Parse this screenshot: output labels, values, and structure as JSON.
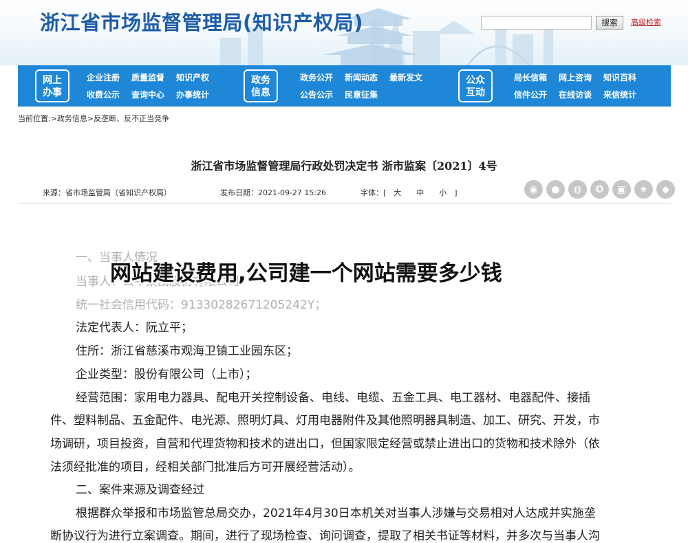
{
  "header": {
    "site_title": "浙江省市场监督管理局(知识产权局)",
    "search_button": "搜索",
    "advanced_search": "高级检索"
  },
  "nav": {
    "groups": [
      {
        "badge": [
          "网上",
          "办事"
        ],
        "links": [
          "企业注册",
          "质量监督",
          "知识产权",
          "收费公示",
          "查询中心",
          "办事统计"
        ]
      },
      {
        "badge": [
          "政务",
          "信息"
        ],
        "links": [
          "政务公开",
          "新闻动态",
          "最新发文",
          "公告公示",
          "民意征集"
        ]
      },
      {
        "badge": [
          "公众",
          "互动"
        ],
        "links": [
          "局长信箱",
          "网上咨询",
          "知识百科",
          "信件公开",
          "在线访谈",
          "来信统计"
        ]
      }
    ]
  },
  "breadcrumb": "当前位置:>政务信息>反垄断、反不正当竞争",
  "article": {
    "title": "浙江省市场监督管理局行政处罚决定书 浙市监案〔2021〕4号",
    "source": "来源：省市场监管局（省知识产权局）",
    "date": "发布日期：2021-09-27 15:26",
    "font_size": "字体：[　大　　中　　小　]",
    "share_icons": [
      "weibo-icon",
      "wechat-icon",
      "qq-icon",
      "qzone-icon",
      "douban-icon",
      "star-icon",
      "other-icon"
    ]
  },
  "body": {
    "lines": [
      "一、当事人情况",
      "当事人：公牛集团股份有限公司",
      "统一社会信用代码：91330282671205242Y；",
      "法定代表人：阮立平；",
      "住所：浙江省慈溪市观海卫镇工业园东区；",
      "企业类型：股份有限公司（上市）；",
      "经营范围：家用电力器具、配电开关控制设备、电线、电缆、五金工具、电工器材、电器配件、接插",
      "件、塑料制品、五金配件、电光源、照明灯具、灯用电器附件及其他照明器具制造、加工、研究、开发，市",
      "场调研，项目投资，自营和代理货物和技术的进出口，但国家限定经营或禁止进出口的货物和技术除外（依",
      "法须经批准的项目，经相关部门批准后方可开展经营活动）。",
      "二、案件来源及调查经过",
      "根据群众举报和市场监管总局交办，2021年4月30日本机关对当事人涉嫌与交易相对人达成并实施垄",
      "断协议行为进行立案调查。期间，进行了现场检查、询问调查，提取了相关书证等材料，并多次与当事人沟"
    ]
  },
  "overlay_title": "网站建设费用,公司建一个网站需要多少钱"
}
